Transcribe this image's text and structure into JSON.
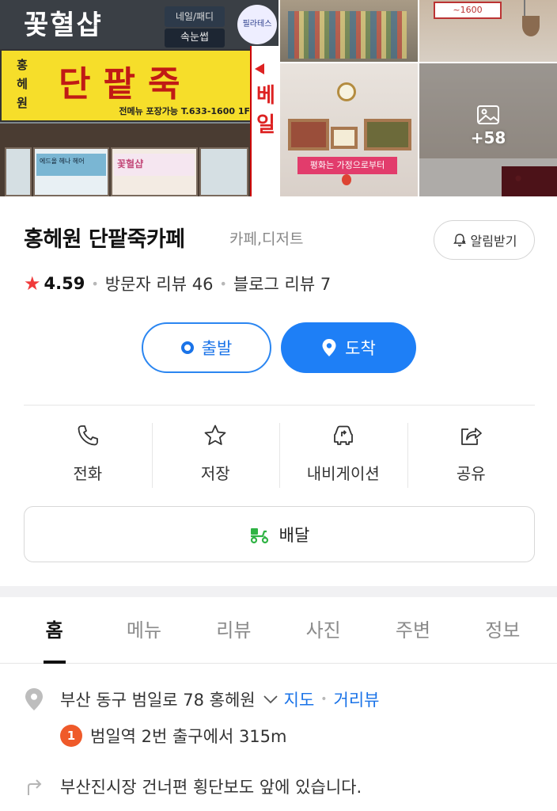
{
  "gallery": {
    "main_signs": {
      "hanja": "꽃혈샵",
      "mini1": "네일/패디",
      "mini2": "속눈썹",
      "round": "필라테스",
      "yellow_vertical": "홍헤원",
      "yellow_main": "단팥죽",
      "yellow_sub": "전메뉴 포장가능 T.633-1600 1F",
      "side_text": "베일",
      "banner1": "에드올 헤나 헤어",
      "banner2": "꽃혈샵"
    },
    "s2_sign": "~1600",
    "s3_banner": "평화는 가정으로부터",
    "more_count": "+58"
  },
  "place": {
    "name": "홍헤원 단팥죽카페",
    "category": "카페,디저트",
    "alarm_label": "알림받기",
    "rating": "4.59",
    "visitor_reviews": "방문자 리뷰 46",
    "blog_reviews": "블로그 리뷰 7"
  },
  "directions": {
    "start_label": "출발",
    "arrive_label": "도착"
  },
  "actions": [
    {
      "label": "전화",
      "icon": "phone-icon"
    },
    {
      "label": "저장",
      "icon": "star-icon"
    },
    {
      "label": "내비게이션",
      "icon": "car-navigation-icon"
    },
    {
      "label": "공유",
      "icon": "share-icon"
    }
  ],
  "delivery": {
    "label": "배달",
    "icon": "delivery-scooter-icon"
  },
  "tabs": [
    "홈",
    "메뉴",
    "리뷰",
    "사진",
    "주변",
    "정보"
  ],
  "active_tab": "홈",
  "address": {
    "text": "부산 동구 범일로 78 홍헤원",
    "map_link": "지도",
    "street_view_link": "거리뷰",
    "station_number": "1",
    "station_text": "범일역 2번 출구에서 315m",
    "directions_text": "부산진시장 건너편 횡단보도 앞에 있습니다."
  },
  "colors": {
    "accent_blue": "#1e7ff6",
    "rating_star": "#f03a3a",
    "station_badge": "#ef5a2a",
    "delivery_green": "#2fb344"
  }
}
